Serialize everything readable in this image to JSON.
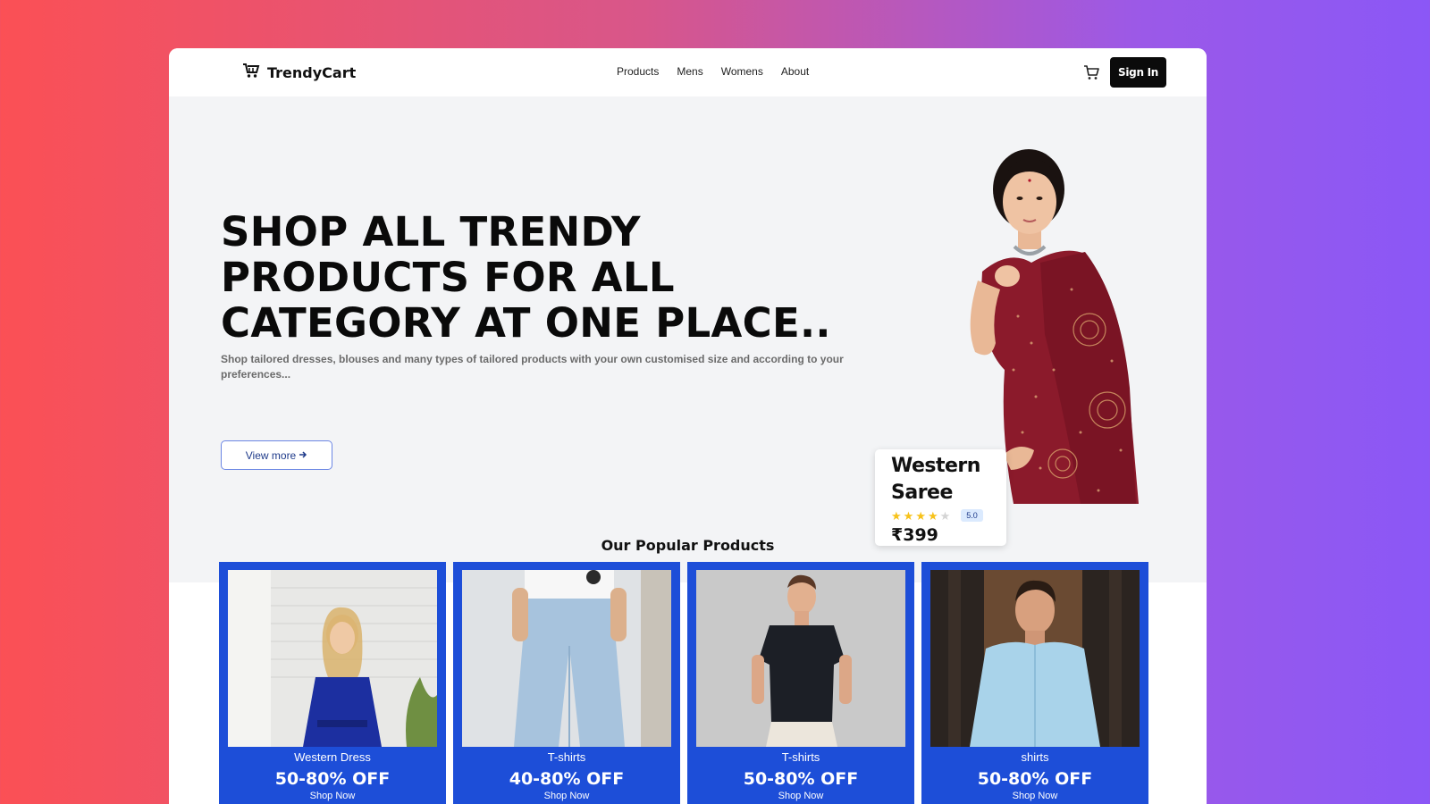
{
  "brand": {
    "name": "TrendyCart",
    "icon": "cart-logo-icon"
  },
  "nav": {
    "links": [
      "Products",
      "Mens",
      "Womens",
      "About"
    ]
  },
  "header": {
    "cart_icon": "cart-icon",
    "signin_label": "Sign In"
  },
  "hero": {
    "title": "SHOP ALL TRENDY PRODUCTS FOR ALL CATEGORY AT ONE PLACE..",
    "subtitle": "Shop tailored dresses, blouses and many types of tailored products with your own customised size and according to your preferences...",
    "cta_label": "View more",
    "cta_icon": "arrow-right-icon",
    "featured": {
      "name": "Western Saree",
      "rating": 4,
      "rating_max": 5,
      "rating_badge": "5.0",
      "price": "₹399"
    }
  },
  "popular": {
    "title": "Our Popular Products",
    "items": [
      {
        "name": "Western Dress",
        "offer": "50-80% OFF",
        "cta": "Shop Now"
      },
      {
        "name": "T-shirts",
        "offer": "40-80% OFF",
        "cta": "Shop Now"
      },
      {
        "name": "T-shirts",
        "offer": "50-80% OFF",
        "cta": "Shop Now"
      },
      {
        "name": "shirts",
        "offer": "50-80% OFF",
        "cta": "Shop Now"
      }
    ]
  },
  "colors": {
    "accent_blue": "#1d4ed8",
    "button_dark": "#0b0b0b",
    "hero_bg": "#f3f4f6",
    "saree": "#8b1a2b",
    "star": "#f7c21a"
  }
}
